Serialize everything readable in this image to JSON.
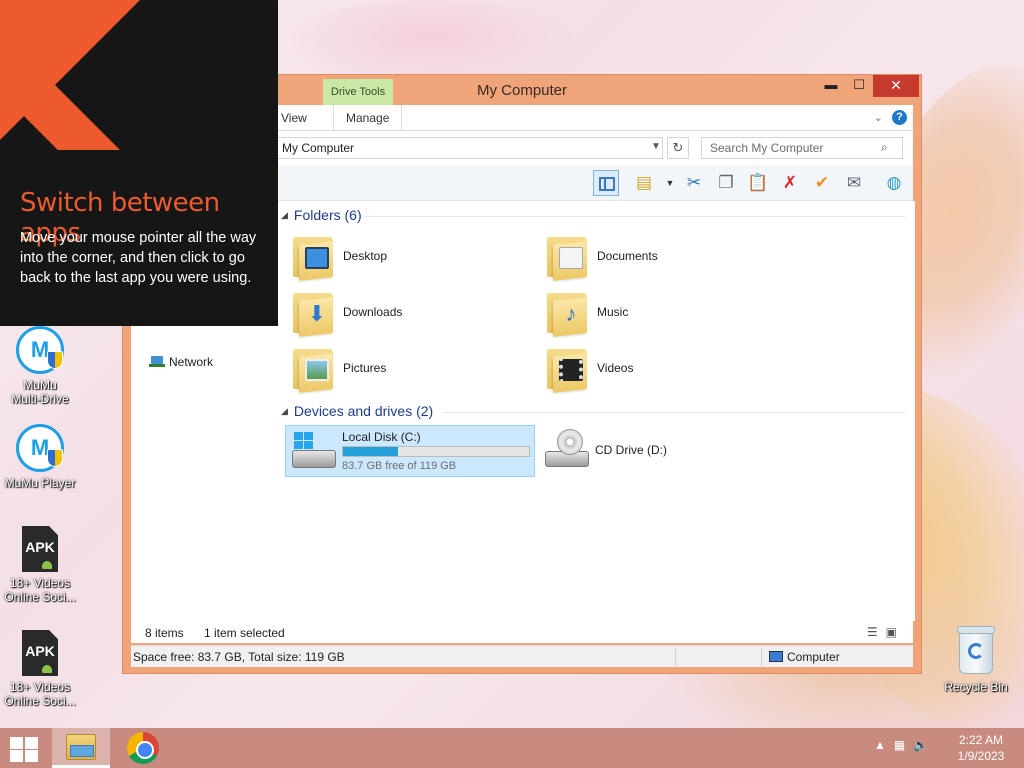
{
  "tip": {
    "title": "Switch between apps",
    "body": "Move your mouse pointer all the way into the corner, and then click to go back to the last app you were using."
  },
  "desktop": {
    "icons": [
      {
        "label_line1": "MuMu",
        "label_line2": "Multi-Drive",
        "icon": "mumu-multi-drive-icon"
      },
      {
        "label_line1": "MuMu Player",
        "label_line2": "",
        "icon": "mumu-player-icon"
      },
      {
        "label_line1": "18+ Videos",
        "label_line2": "Online Soci...",
        "icon": "apk-file-icon"
      },
      {
        "label_line1": "18+ Videos",
        "label_line2": "Online Soci...",
        "icon": "apk-file-icon"
      }
    ],
    "apk_text": "APK",
    "mumu_glyph": "M",
    "recycle_bin": "Recycle Bin"
  },
  "window": {
    "title": "My Computer",
    "context_tab": "Drive Tools",
    "tabs": [
      "View",
      "Manage"
    ],
    "controls": {
      "minimize": "▬",
      "maximize": "☐",
      "close": "✕"
    },
    "help": "?",
    "address": "My Computer",
    "search_placeholder": "Search My Computer",
    "nav": {
      "network": "Network"
    },
    "groups": {
      "folders": "Folders (6)",
      "drives": "Devices and drives (2)"
    },
    "folders": [
      {
        "name": "Desktop",
        "icon": "desktop-folder-icon"
      },
      {
        "name": "Documents",
        "icon": "documents-folder-icon"
      },
      {
        "name": "Downloads",
        "icon": "downloads-folder-icon"
      },
      {
        "name": "Music",
        "icon": "music-folder-icon"
      },
      {
        "name": "Pictures",
        "icon": "pictures-folder-icon"
      },
      {
        "name": "Videos",
        "icon": "videos-folder-icon"
      }
    ],
    "drives": [
      {
        "name": "Local Disk (C:)",
        "free_text": "83.7 GB free of 119 GB",
        "used_fraction": 0.297,
        "selected": true
      },
      {
        "name": "CD Drive (D:)"
      }
    ],
    "status": {
      "items": "8 items",
      "selected": "1 item selected"
    },
    "details": {
      "space": "Space free: 83.7 GB, Total size: 119 GB",
      "location": "Computer"
    }
  },
  "taskbar": {
    "apps": [
      "file-explorer-icon",
      "chrome-icon"
    ],
    "time": "2:22 AM",
    "date": "1/9/2023"
  },
  "colors": {
    "accent": "#ec5a2d",
    "window_frame": "#f0a47a",
    "selection": "#cce8ff",
    "drive_fill": "#26a0da"
  }
}
